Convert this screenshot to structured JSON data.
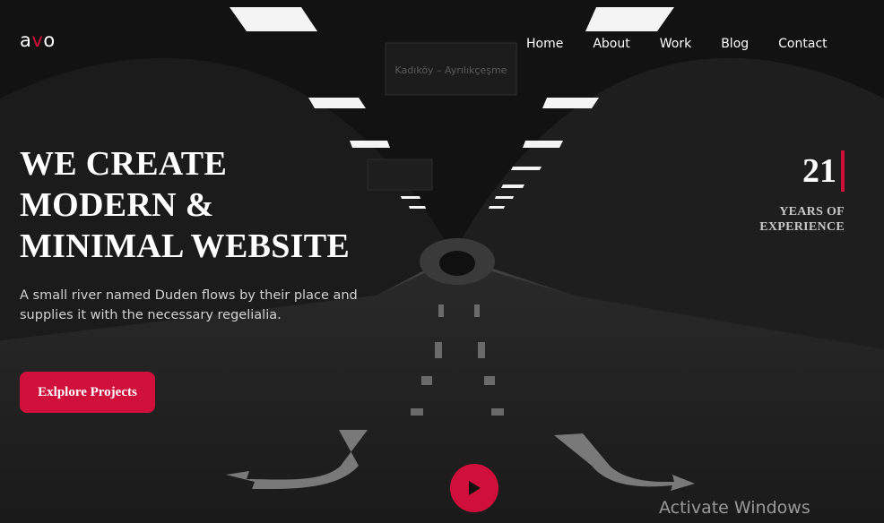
{
  "brand": {
    "logo_a": "a",
    "logo_v": "v",
    "logo_o": "o",
    "accent": "#d0103a"
  },
  "nav": {
    "items": [
      {
        "label": "Home"
      },
      {
        "label": "About"
      },
      {
        "label": "Work"
      },
      {
        "label": "Blog"
      },
      {
        "label": "Contact"
      }
    ]
  },
  "hero": {
    "headline": [
      "WE CREATE",
      "MODERN &",
      "MINIMAL WEBSITE"
    ],
    "subtitle": "A small river named Duden flows by their place and supplies it with the necessary regelialia.",
    "cta_label": "Exlplore Projects"
  },
  "stat": {
    "number": "21",
    "label_line1": "YEARS OF",
    "label_line2": "EXPERIENCE"
  },
  "background": {
    "sign_text": "Kadıköy – Ayrılıkçeşme"
  },
  "play_button": {
    "icon": "play-icon"
  },
  "watermark": {
    "text": "Activate Windows"
  }
}
